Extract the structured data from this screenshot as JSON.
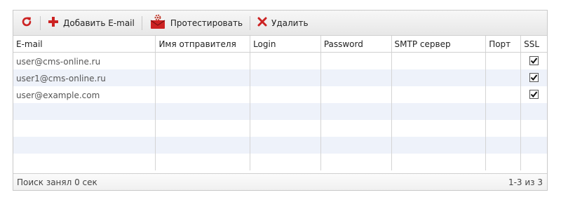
{
  "toolbar": {
    "add_label": "Добавить E-mail",
    "test_label": "Протестировать",
    "delete_label": "Удалить"
  },
  "columns": {
    "email": "E-mail",
    "sender_name": "Имя отправителя",
    "login": "Login",
    "password": "Password",
    "smtp": "SMTP сервер",
    "port": "Порт",
    "ssl": "SSL"
  },
  "rows": [
    {
      "email": "user@cms-online.ru",
      "sender_name": "",
      "login": "",
      "password": "",
      "smtp": "",
      "port": "",
      "ssl": true
    },
    {
      "email": "user1@cms-online.ru",
      "sender_name": "",
      "login": "",
      "password": "",
      "smtp": "",
      "port": "",
      "ssl": true
    },
    {
      "email": "user@example.com",
      "sender_name": "",
      "login": "",
      "password": "",
      "smtp": "",
      "port": "",
      "ssl": true
    }
  ],
  "footer": {
    "status": "Поиск занял 0 сек",
    "paging": "1-3 из 3"
  },
  "colors": {
    "accent": "#cc2222",
    "row_alt": "#eef2fa"
  }
}
